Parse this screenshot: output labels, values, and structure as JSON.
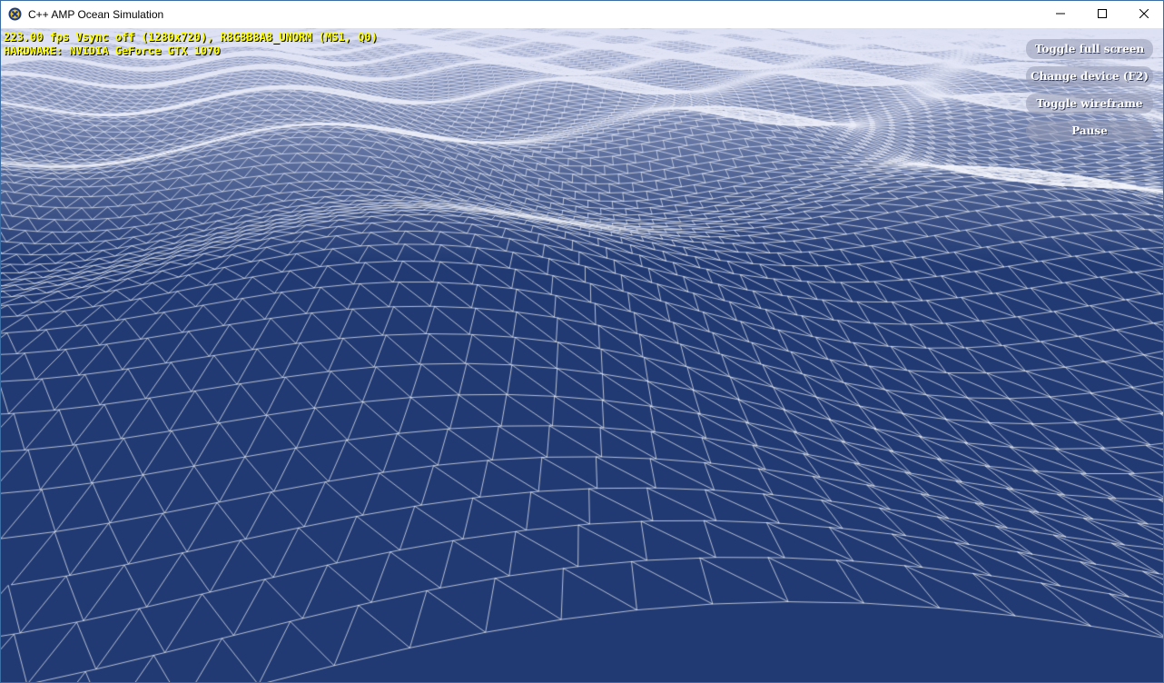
{
  "window": {
    "title": "C++ AMP Ocean Simulation",
    "controls": {
      "minimize": "minimize",
      "maximize": "maximize",
      "close": "close"
    }
  },
  "stats": {
    "line1": "223.00 fps Vsync off (1280x720), R8G8B8A8_UNORM (MS1, Q0)",
    "line2": "HARDWARE: NVIDIA GeForce GTX 1070"
  },
  "hud": {
    "buttons": [
      {
        "label": "Toggle full screen"
      },
      {
        "label": "Change device (F2)"
      },
      {
        "label": "Toggle wireframe"
      },
      {
        "label": "Pause"
      }
    ]
  },
  "colors": {
    "water": "#213a74",
    "wire": "#ffffff",
    "stats_text": "#ffff00",
    "titlebar_bg": "#ffffff"
  },
  "icons": {
    "app": "amp-logo-icon",
    "minimize": "minimize-icon",
    "maximize": "maximize-icon",
    "close": "close-icon"
  }
}
